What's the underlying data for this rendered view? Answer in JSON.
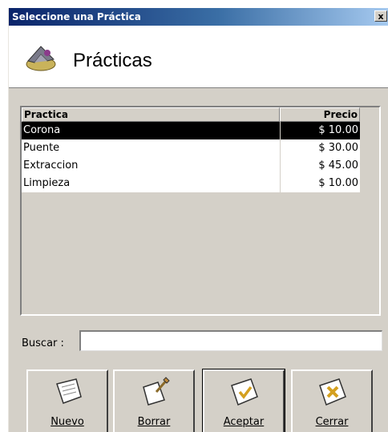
{
  "window": {
    "title": "Seleccione una Práctica",
    "close_glyph": "x"
  },
  "header": {
    "title": "Prácticas",
    "icon": "practice-icon"
  },
  "grid": {
    "columns": [
      "Practica",
      "Precio"
    ],
    "rows": [
      {
        "practica": "Corona",
        "precio": "$ 10.00"
      },
      {
        "practica": "Puente",
        "precio": "$ 30.00"
      },
      {
        "practica": "Extraccion",
        "precio": "$ 45.00"
      },
      {
        "practica": "Limpieza",
        "precio": "$ 10.00"
      }
    ],
    "selected_index": 0
  },
  "search": {
    "label": "Buscar :",
    "value": ""
  },
  "buttons": {
    "nuevo": "Nuevo",
    "borrar": "Borrar",
    "aceptar": "Aceptar",
    "cerrar": "Cerrar"
  },
  "colors": {
    "titlebar": "#0a246a",
    "selection": "#000000",
    "face": "#d4d0c8"
  }
}
